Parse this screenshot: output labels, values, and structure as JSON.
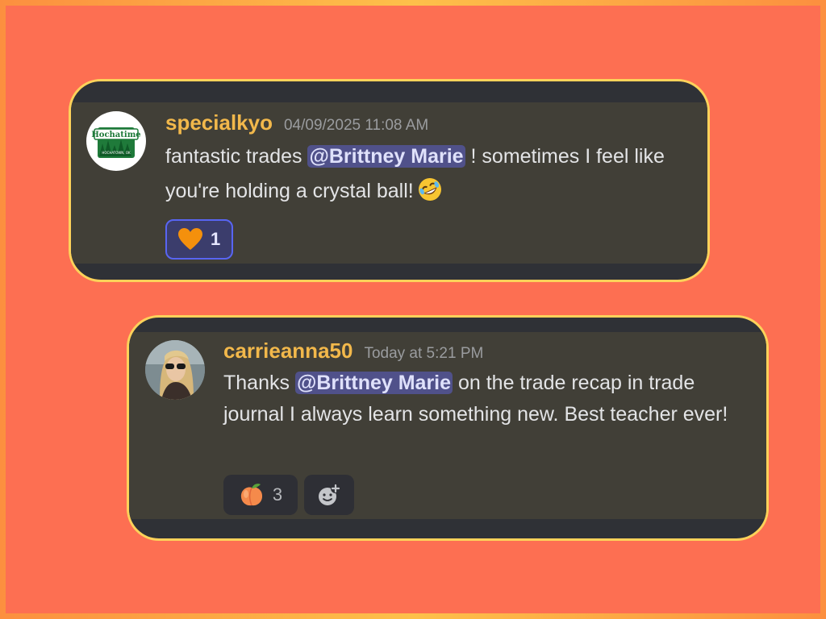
{
  "messages": [
    {
      "username": "specialkyo",
      "timestamp": "04/09/2025 11:08 AM",
      "text_before": "fantastic trades ",
      "mention": "@Brittney Marie",
      "text_after": " ! sometimes I feel like you're holding a crystal ball!",
      "inline_emoji": "rolling-on-floor-laughing-emoji",
      "avatar_text": "Hochatime",
      "avatar_subtext": "HOCHATOWN, OK",
      "reactions": [
        {
          "emoji": "orange-heart-emoji",
          "count": "1",
          "active": true
        }
      ]
    },
    {
      "username": "carrieanna50",
      "timestamp": "Today at 5:21 PM",
      "text_before": "Thanks ",
      "mention": "@Brittney Marie",
      "text_after": " on the trade recap in trade journal I always learn something new. Best teacher ever!",
      "avatar": "woman-with-sunglasses-photo",
      "reactions": [
        {
          "emoji": "peach-emoji",
          "count": "3",
          "active": false
        }
      ],
      "add_reaction_icon": "add-reaction-icon"
    }
  ],
  "colors": {
    "background": "#fd6f52",
    "frame_border": "#fcae38",
    "card_border": "#fdd25a",
    "card_bg": "#413f37",
    "username": "#f2b84b",
    "mention_bg": "#50518a",
    "active_reaction_border": "#5865f2"
  }
}
